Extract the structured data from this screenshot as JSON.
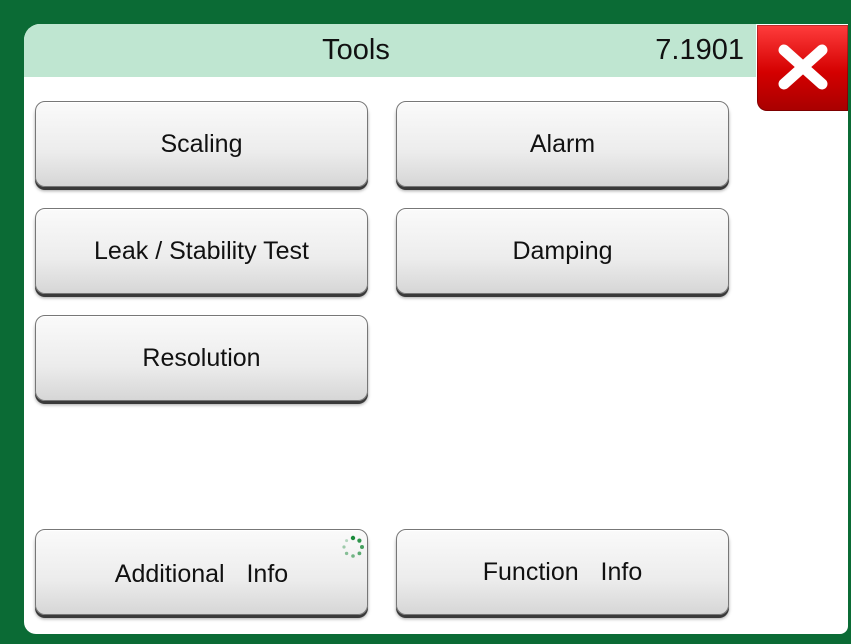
{
  "header": {
    "title": "Tools",
    "version": "7.1901"
  },
  "buttons": {
    "scaling": "Scaling",
    "alarm": "Alarm",
    "leak": "Leak / Stability Test",
    "damping": "Damping",
    "resolution": "Resolution",
    "additional_info": "Additional  Info",
    "function_info": "Function  Info"
  },
  "icons": {
    "close": "close-icon",
    "spinner": "loading-spinner-icon"
  },
  "colors": {
    "frame": "#0b6b35",
    "titlebar": "#bfe6d1",
    "close": "#d40000",
    "spinner": "#1a8a3a"
  }
}
